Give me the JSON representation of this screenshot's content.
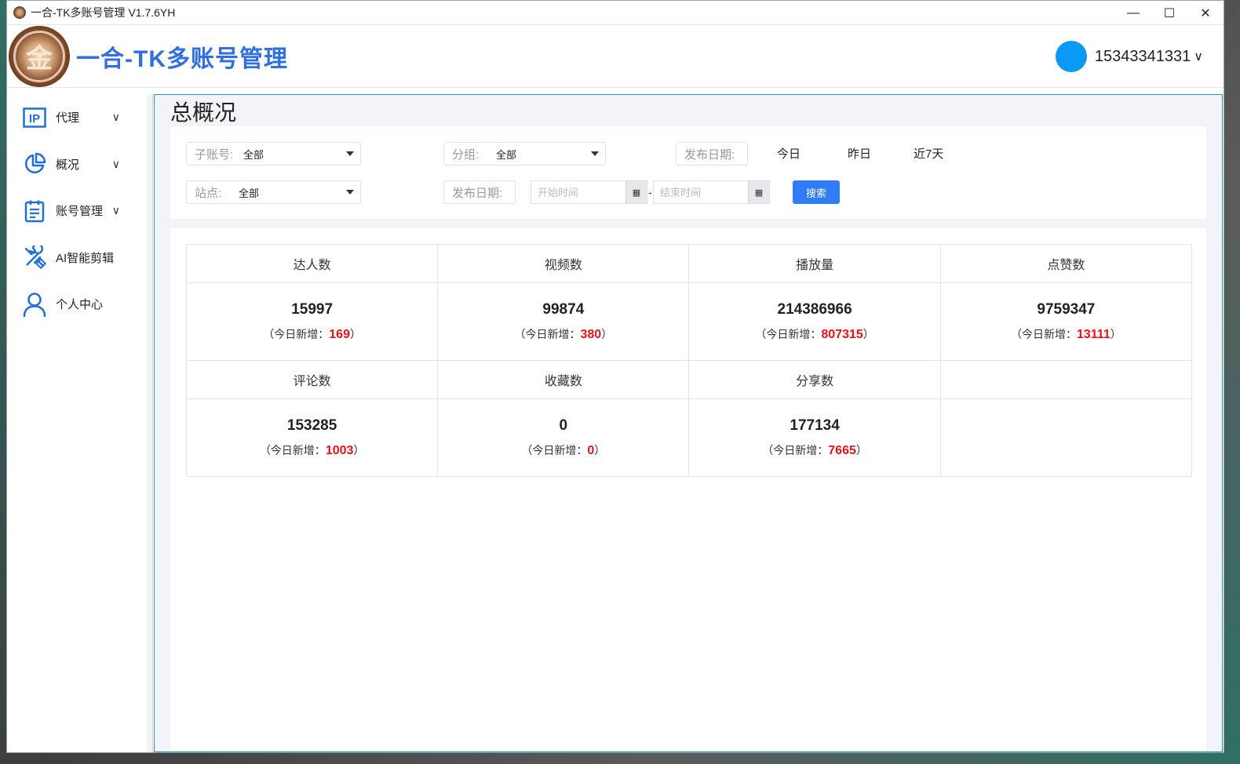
{
  "window": {
    "title": "一合-TK多账号管理 V1.7.6YH",
    "controls": {
      "minimize": "—",
      "maximize": "☐",
      "close": "✕"
    }
  },
  "header": {
    "logo_glyph": "金",
    "brand": "一合-TK多账号管理",
    "user_phone": "15343341331",
    "user_chevron": "∨",
    "avatar_color": "#0a98f5"
  },
  "sidebar": {
    "items": [
      {
        "label": "代理",
        "icon": "ip-icon",
        "has_chevron": true
      },
      {
        "label": "概况",
        "icon": "pie-chart-icon",
        "has_chevron": true
      },
      {
        "label": "账号管理",
        "icon": "clipboard-icon",
        "has_chevron": true
      },
      {
        "label": "AI智能剪辑",
        "icon": "tools-icon",
        "has_chevron": false
      },
      {
        "label": "个人中心",
        "icon": "user-icon",
        "has_chevron": false
      }
    ],
    "chevron": "∨"
  },
  "main": {
    "page_title": "总概况",
    "filters": {
      "sub_account_label": "子账号:",
      "sub_account_value": "全部",
      "group_label": "分组:",
      "group_value": "全部",
      "publish_date_label": "发布日期:",
      "quick_today": "今日",
      "quick_yesterday": "昨日",
      "quick_7days": "近7天",
      "site_label": "站点:",
      "site_value": "全部",
      "publish_date_label2": "发布日期:",
      "start_placeholder": "开始时间",
      "end_placeholder": "结束时间",
      "range_dash": "-",
      "search_button": "搜索"
    },
    "stats": {
      "new_today_prefix": "（今日新增：",
      "new_today_suffix": "）",
      "row1": [
        {
          "label": "达人数",
          "value": "15997",
          "new_today": "169"
        },
        {
          "label": "视频数",
          "value": "99874",
          "new_today": "380"
        },
        {
          "label": "播放量",
          "value": "214386966",
          "new_today": "807315"
        },
        {
          "label": "点赞数",
          "value": "9759347",
          "new_today": "13111"
        }
      ],
      "row2": [
        {
          "label": "评论数",
          "value": "153285",
          "new_today": "1003"
        },
        {
          "label": "收藏数",
          "value": "0",
          "new_today": "0"
        },
        {
          "label": "分享数",
          "value": "177134",
          "new_today": "7665"
        }
      ]
    }
  },
  "colors": {
    "brand_blue": "#2f6fe0",
    "accent_red": "#e4121b",
    "button_blue": "#2f7df6"
  }
}
